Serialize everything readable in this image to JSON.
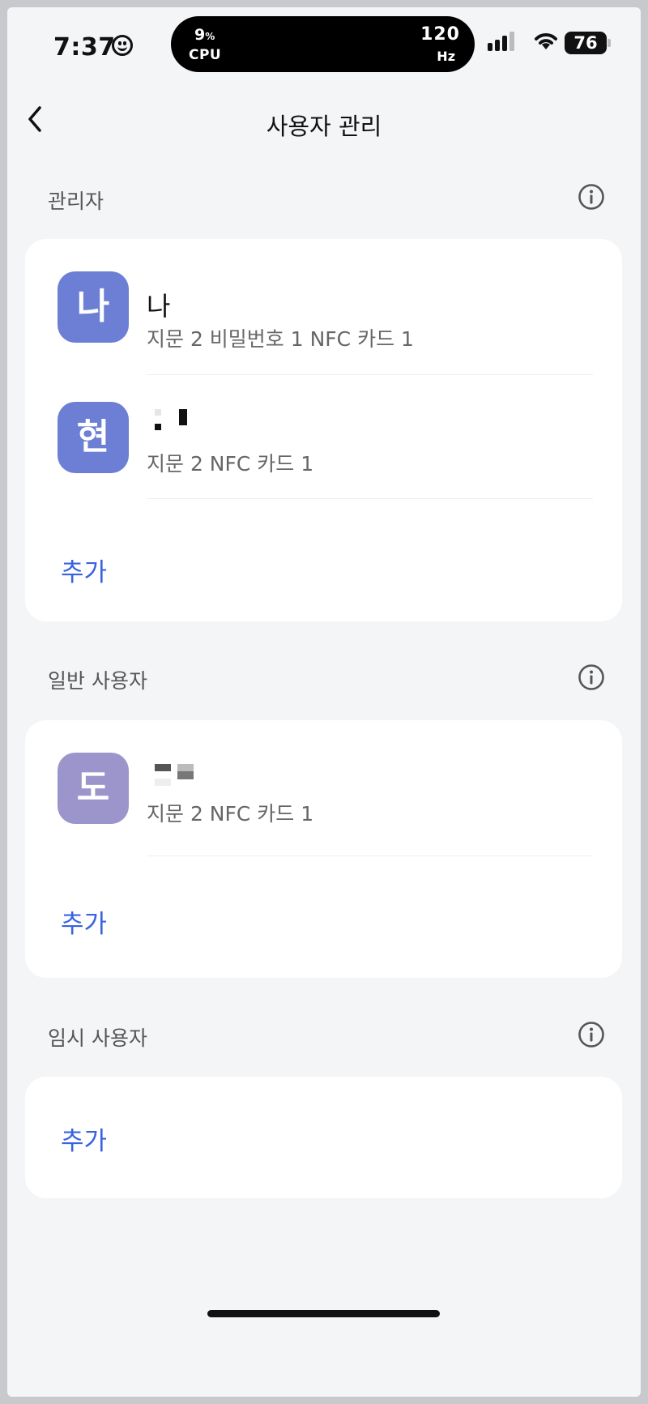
{
  "status_bar": {
    "time": "7:37",
    "cpu_percent": "9",
    "cpu_percent_unit": "%",
    "cpu_label": "CPU",
    "refresh_rate": "120",
    "refresh_rate_unit": "Hz",
    "battery": "76"
  },
  "header": {
    "title": "사용자 관리"
  },
  "sections": {
    "admin": {
      "title": "관리자",
      "users": [
        {
          "avatar_initial": "나",
          "avatar_color": "#6c7fd4",
          "name": "나",
          "detail": "지문 2 비밀번호 1 NFC 카드 1"
        },
        {
          "avatar_initial": "현",
          "avatar_color": "#6c7fd4",
          "name": "",
          "detail": "지문 2 NFC 카드 1"
        }
      ],
      "add_label": "추가"
    },
    "general": {
      "title": "일반 사용자",
      "users": [
        {
          "avatar_initial": "도",
          "avatar_color": "#9b95cc",
          "name": "",
          "detail": "지문 2 NFC 카드 1"
        }
      ],
      "add_label": "추가"
    },
    "temporary": {
      "title": "임시 사용자",
      "add_label": "추가"
    }
  },
  "colors": {
    "accent": "#3a62e0",
    "background": "#f4f5f7"
  }
}
